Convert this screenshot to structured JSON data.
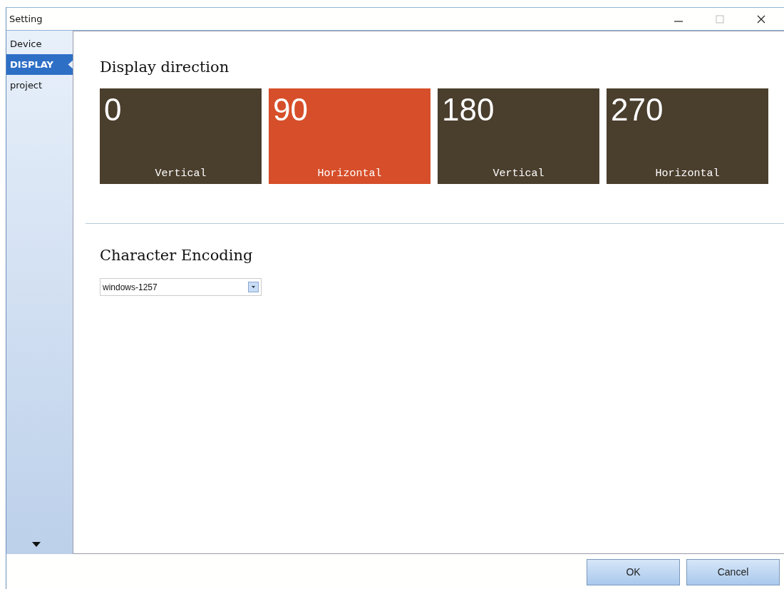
{
  "window": {
    "title": "Setting"
  },
  "sidebar": {
    "items": [
      {
        "label": "Device",
        "selected": false
      },
      {
        "label": "DISPLAY",
        "selected": true
      },
      {
        "label": "project",
        "selected": false
      }
    ]
  },
  "display_direction": {
    "heading": "Display direction",
    "tiles": [
      {
        "angle": "0",
        "label": "Vertical",
        "selected": false
      },
      {
        "angle": "90",
        "label": "Horizontal",
        "selected": true
      },
      {
        "angle": "180",
        "label": "Vertical",
        "selected": false
      },
      {
        "angle": "270",
        "label": "Horizontal",
        "selected": false
      }
    ]
  },
  "character_encoding": {
    "heading": "Character Encoding",
    "value": "windows-1257"
  },
  "buttons": [
    "OK",
    "Cancel"
  ]
}
